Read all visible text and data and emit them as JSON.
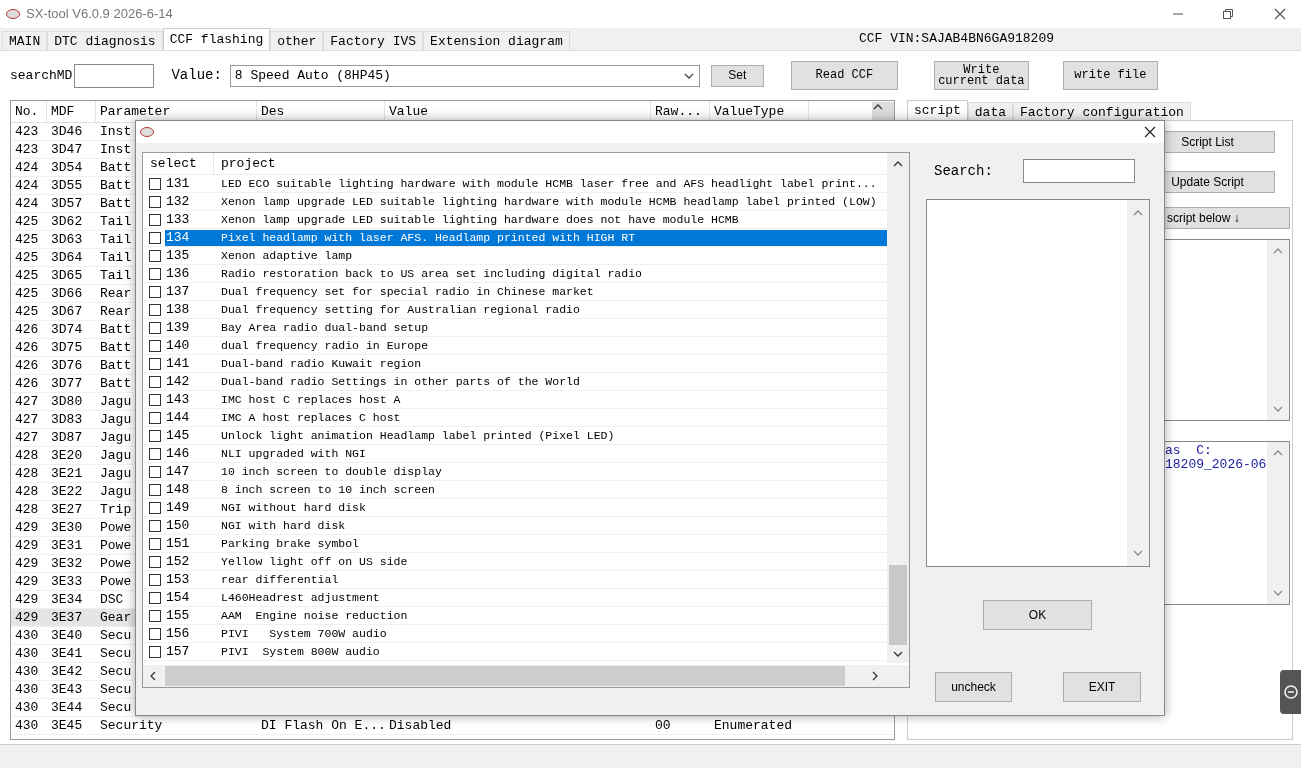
{
  "window": {
    "title": "SX-tool V6.0.9  2026-6-14"
  },
  "tabs": [
    {
      "label": "MAIN",
      "selected": false
    },
    {
      "label": "DTC diagnosis",
      "selected": false
    },
    {
      "label": "CCF flashing",
      "selected": true
    },
    {
      "label": "other",
      "selected": false
    },
    {
      "label": "Factory IVS",
      "selected": false
    },
    {
      "label": "Extension diagram",
      "selected": false
    }
  ],
  "vin_label": "CCF VIN:SAJAB4BN6GA918209",
  "toolbar": {
    "search_label": "searchMD",
    "value_label": "Value:",
    "value_selected": "8 Speed Auto (8HP45)",
    "set_button": "Set",
    "read_button": "Read CCF",
    "write_current_button": "Write current data",
    "write_file_button": "write file"
  },
  "table": {
    "columns": [
      "No.",
      "MDF",
      "Parameter",
      "Des",
      "Value",
      "Raw...",
      "ValueType"
    ],
    "rows": [
      {
        "no": "423",
        "mdf": "3D46",
        "parameter": "Inst",
        "selected": false
      },
      {
        "no": "423",
        "mdf": "3D47",
        "parameter": "Inst",
        "selected": false
      },
      {
        "no": "424",
        "mdf": "3D54",
        "parameter": "Batt",
        "selected": false
      },
      {
        "no": "424",
        "mdf": "3D55",
        "parameter": "Batt",
        "selected": false
      },
      {
        "no": "424",
        "mdf": "3D57",
        "parameter": "Batt",
        "selected": false
      },
      {
        "no": "425",
        "mdf": "3D62",
        "parameter": "Tail",
        "selected": false
      },
      {
        "no": "425",
        "mdf": "3D63",
        "parameter": "Tail",
        "selected": false
      },
      {
        "no": "425",
        "mdf": "3D64",
        "parameter": "Tail",
        "selected": false
      },
      {
        "no": "425",
        "mdf": "3D65",
        "parameter": "Tail",
        "selected": false
      },
      {
        "no": "425",
        "mdf": "3D66",
        "parameter": "Rear",
        "selected": false
      },
      {
        "no": "425",
        "mdf": "3D67",
        "parameter": "Rear",
        "selected": false
      },
      {
        "no": "426",
        "mdf": "3D74",
        "parameter": "Batt",
        "selected": false
      },
      {
        "no": "426",
        "mdf": "3D75",
        "parameter": "Batt",
        "selected": false
      },
      {
        "no": "426",
        "mdf": "3D76",
        "parameter": "Batt",
        "selected": false
      },
      {
        "no": "426",
        "mdf": "3D77",
        "parameter": "Batt",
        "selected": false
      },
      {
        "no": "427",
        "mdf": "3D80",
        "parameter": "Jagu",
        "selected": false
      },
      {
        "no": "427",
        "mdf": "3D83",
        "parameter": "Jagu",
        "selected": false
      },
      {
        "no": "427",
        "mdf": "3D87",
        "parameter": "Jagu",
        "selected": false
      },
      {
        "no": "428",
        "mdf": "3E20",
        "parameter": "Jagu",
        "selected": false
      },
      {
        "no": "428",
        "mdf": "3E21",
        "parameter": "Jagu",
        "selected": false
      },
      {
        "no": "428",
        "mdf": "3E22",
        "parameter": "Jagu",
        "selected": false
      },
      {
        "no": "428",
        "mdf": "3E27",
        "parameter": "Trip",
        "selected": false
      },
      {
        "no": "429",
        "mdf": "3E30",
        "parameter": "Powe",
        "selected": false
      },
      {
        "no": "429",
        "mdf": "3E31",
        "parameter": "Powe",
        "selected": false
      },
      {
        "no": "429",
        "mdf": "3E32",
        "parameter": "Powe",
        "selected": false
      },
      {
        "no": "429",
        "mdf": "3E33",
        "parameter": "Powe",
        "selected": false
      },
      {
        "no": "429",
        "mdf": "3E34",
        "parameter": "DSC",
        "selected": false
      },
      {
        "no": "429",
        "mdf": "3E37",
        "parameter": "Gear",
        "selected": true
      },
      {
        "no": "430",
        "mdf": "3E40",
        "parameter": "Secu",
        "selected": false
      },
      {
        "no": "430",
        "mdf": "3E41",
        "parameter": "Secu",
        "selected": false
      },
      {
        "no": "430",
        "mdf": "3E42",
        "parameter": "Secu",
        "selected": false
      },
      {
        "no": "430",
        "mdf": "3E43",
        "parameter": "Secu",
        "selected": false
      },
      {
        "no": "430",
        "mdf": "3E44",
        "parameter": "Secu",
        "selected": false
      },
      {
        "no": "430",
        "mdf": "3E45",
        "parameter": "Security",
        "des": "DI Flash On E...",
        "value": "Disabled",
        "raw": "00",
        "value_type": "Enumerated",
        "selected": false
      }
    ]
  },
  "side_panel": {
    "tabs": [
      {
        "label": "script",
        "selected": true
      },
      {
        "label": "data",
        "selected": false
      },
      {
        "label": "Factory configuration",
        "selected": false
      }
    ],
    "buttons": [
      "Script List",
      "Update Script",
      "script below ↓"
    ],
    "log_lines": [
      "as  C:",
      "18209_2026-06"
    ]
  },
  "dialog": {
    "columns": [
      "select",
      "project"
    ],
    "items": [
      {
        "number": "131",
        "project": "LED ECO suitable lighting hardware with module HCMB laser free and AFS headlight label print...",
        "checked": false,
        "selected": false
      },
      {
        "number": "132",
        "project": "Xenon lamp upgrade LED suitable lighting hardware with module HCMB headlamp label printed (LOW)",
        "checked": false,
        "selected": false
      },
      {
        "number": "133",
        "project": "Xenon lamp upgrade LED suitable lighting hardware does not have module HCMB",
        "checked": false,
        "selected": false
      },
      {
        "number": "134",
        "project": "Pixel headlamp with laser AFS. Headlamp printed with HIGH RT",
        "checked": false,
        "selected": true
      },
      {
        "number": "135",
        "project": "Xenon adaptive lamp",
        "checked": false,
        "selected": false
      },
      {
        "number": "136",
        "project": "Radio restoration back to US area set including digital radio",
        "checked": false,
        "selected": false
      },
      {
        "number": "137",
        "project": "Dual frequency set for special radio in Chinese market",
        "checked": false,
        "selected": false
      },
      {
        "number": "138",
        "project": "Dual frequency setting for Australian regional radio",
        "checked": false,
        "selected": false
      },
      {
        "number": "139",
        "project": "Bay Area radio dual-band setup",
        "checked": false,
        "selected": false
      },
      {
        "number": "140",
        "project": "dual frequency radio in Europe",
        "checked": false,
        "selected": false
      },
      {
        "number": "141",
        "project": "Dual-band radio Kuwait region",
        "checked": false,
        "selected": false
      },
      {
        "number": "142",
        "project": "Dual-band radio Settings in other parts of the World",
        "checked": false,
        "selected": false
      },
      {
        "number": "143",
        "project": "IMC host C replaces host A",
        "checked": false,
        "selected": false
      },
      {
        "number": "144",
        "project": "IMC A host replaces C host",
        "checked": false,
        "selected": false
      },
      {
        "number": "145",
        "project": "Unlock light animation Headlamp label printed (Pixel LED)",
        "checked": false,
        "selected": false
      },
      {
        "number": "146",
        "project": "NLI upgraded with NGI",
        "checked": false,
        "selected": false
      },
      {
        "number": "147",
        "project": "10 inch screen to double display",
        "checked": false,
        "selected": false
      },
      {
        "number": "148",
        "project": "8 inch screen to 10 inch screen",
        "checked": false,
        "selected": false
      },
      {
        "number": "149",
        "project": "NGI without hard disk",
        "checked": false,
        "selected": false
      },
      {
        "number": "150",
        "project": "NGI with hard disk",
        "checked": false,
        "selected": false
      },
      {
        "number": "151",
        "project": "Parking brake symbol",
        "checked": false,
        "selected": false
      },
      {
        "number": "152",
        "project": "Yellow light off on US side",
        "checked": false,
        "selected": false
      },
      {
        "number": "153",
        "project": "rear differential",
        "checked": false,
        "selected": false
      },
      {
        "number": "154",
        "project": "L460Headrest adjustment",
        "checked": false,
        "selected": false
      },
      {
        "number": "155",
        "project": "AAM  Engine noise reduction",
        "checked": false,
        "selected": false
      },
      {
        "number": "156",
        "project": "PIVI   System 700W audio",
        "checked": false,
        "selected": false
      },
      {
        "number": "157",
        "project": "PIVI  System 800W audio",
        "checked": false,
        "selected": false
      }
    ],
    "search_label": "Search:",
    "ok_button": "OK",
    "uncheck_button": "uncheck",
    "exit_button": "EXIT"
  }
}
